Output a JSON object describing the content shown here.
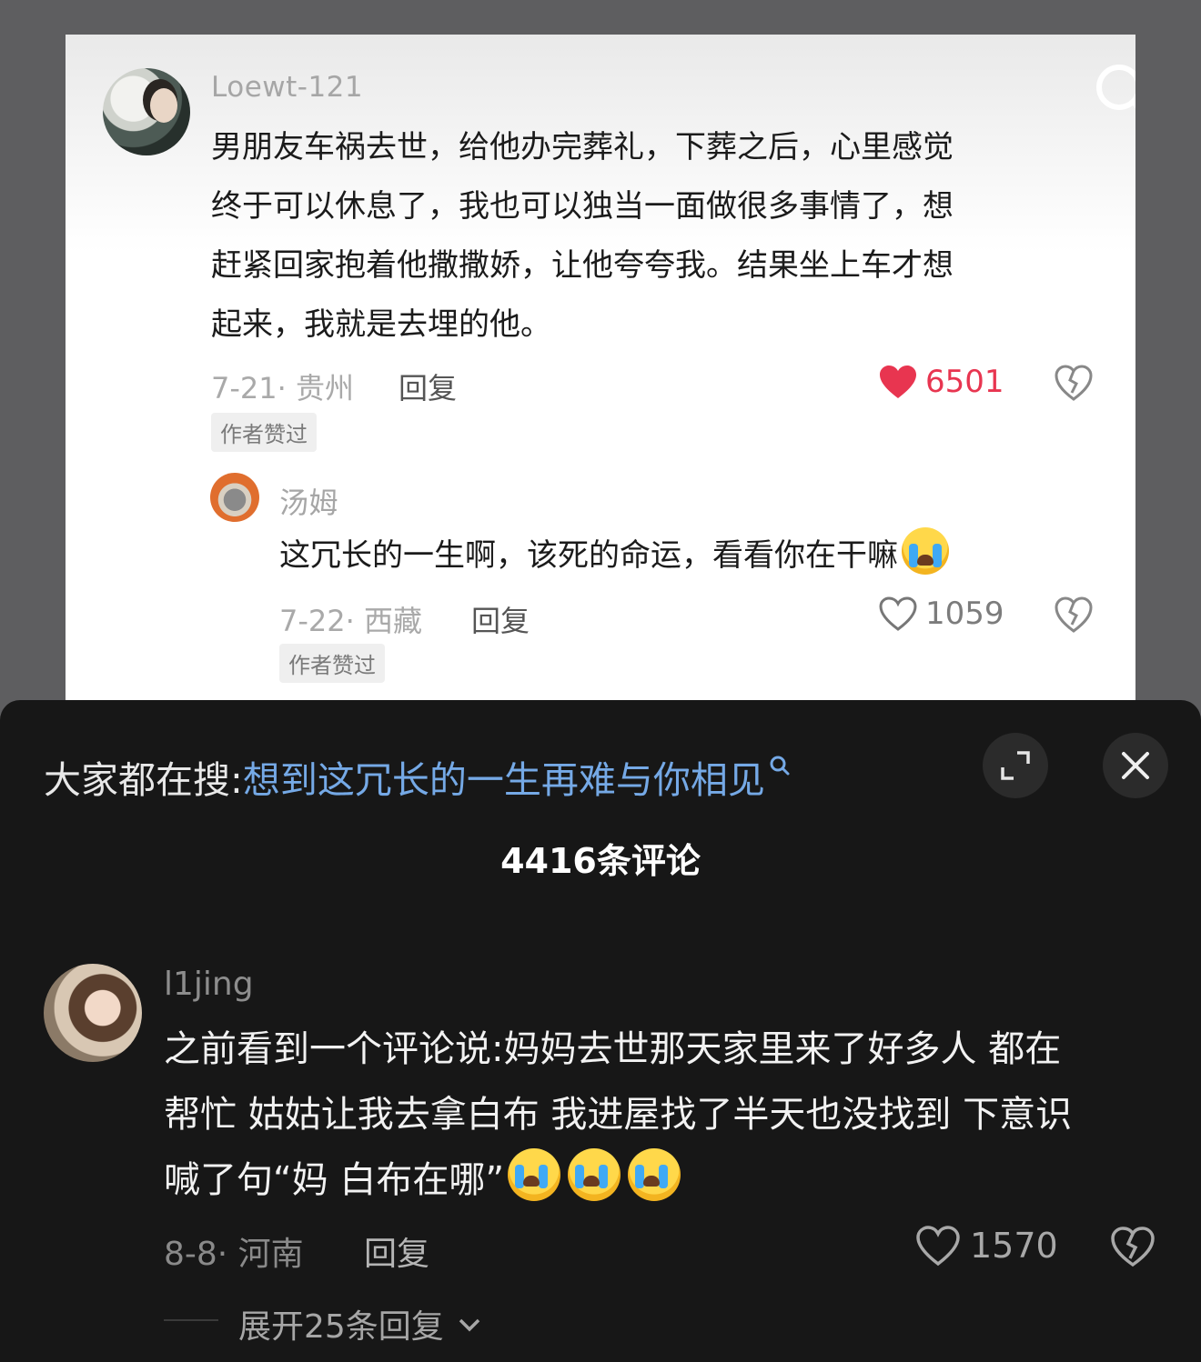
{
  "top_card": {
    "comment": {
      "username": "Loewt-121",
      "lines": [
        "男朋友车祸去世，给他办完葬礼，下葬之后，心里感觉",
        "终于可以休息了，我也可以独当一面做很多事情了，想",
        "赶紧回家抱着他撒撒娇，让他夸夸我。结果坐上车才想",
        "起来，我就是去埋的他。"
      ],
      "meta": "7-21· 贵州",
      "reply_label": "回复",
      "author_tag": "作者赞过",
      "likes": "6501"
    },
    "reply": {
      "username": "汤姆",
      "text": "这冗长的一生啊，该死的命运，看看你在干嘛",
      "meta": "7-22· 西藏",
      "reply_label": "回复",
      "author_tag": "作者赞过",
      "likes": "1059"
    }
  },
  "panel": {
    "hot_search_label": "大家都在搜:",
    "hot_search_query": "想到这冗长的一生再难与你相见",
    "comment_count": "4416条评论",
    "comment": {
      "username": "l1jing",
      "lines": [
        "之前看到一个评论说:妈妈去世那天家里来了好多人 都在",
        "帮忙 姑姑让我去拿白布 我进屋找了半天也没找到 下意识",
        "喊了句“妈 白布在哪”"
      ],
      "meta": "8-8· 河南",
      "reply_label": "回复",
      "likes": "1570",
      "expand_label": "展开25条回复"
    }
  },
  "colors": {
    "like_red": "#e83550",
    "query_blue": "#75a9e6",
    "panel_bg": "#171717"
  },
  "icons": [
    "search-icon",
    "heart-icon",
    "dislike-icon",
    "expand-icon",
    "close-icon",
    "chevron-down-icon",
    "crying-emoji"
  ]
}
